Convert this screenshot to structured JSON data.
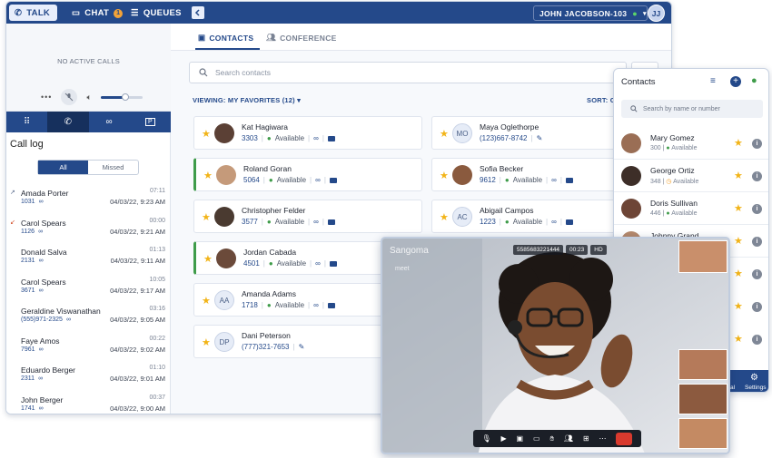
{
  "topbar": {
    "talk": "TALK",
    "chat": "CHAT",
    "chat_count": "1",
    "queues": "QUEUES",
    "user": "JOHN JACOBSON-103",
    "initials": "JJ"
  },
  "left": {
    "no_active": "NO ACTIVE CALLS",
    "volume": 0.6,
    "call_log_title": "Call log",
    "seg_all": "All",
    "seg_missed": "Missed",
    "calls": [
      {
        "name": "Amada Porter",
        "number": "1031",
        "duration": "07:11",
        "date": "04/03/22, 9:23 AM",
        "missed": false
      },
      {
        "name": "Carol Spears",
        "number": "1126",
        "duration": "00:00",
        "date": "04/03/22, 9:21 AM",
        "missed": true
      },
      {
        "name": "Donald Salva",
        "number": "2131",
        "duration": "01:13",
        "date": "04/03/22, 9:11 AM",
        "missed": false
      },
      {
        "name": "Carol Spears",
        "number": "3671",
        "duration": "10:05",
        "date": "04/03/22, 9:17 AM",
        "missed": false
      },
      {
        "name": "Geraldine Viswanathan",
        "number": "(555)971-2325",
        "duration": "03:16",
        "date": "04/03/22, 9:05 AM",
        "missed": false
      },
      {
        "name": "Faye Amos",
        "number": "7961",
        "duration": "00:22",
        "date": "04/03/22, 9:02 AM",
        "missed": false
      },
      {
        "name": "Eduardo Berger",
        "number": "2311",
        "duration": "01:10",
        "date": "04/03/22, 9:01 AM",
        "missed": false
      },
      {
        "name": "John Berger",
        "number": "1741",
        "duration": "00:37",
        "date": "04/03/22, 9:00 AM",
        "missed": false
      }
    ]
  },
  "main": {
    "tab_contacts": "CONTACTS",
    "tab_conference": "CONFERENCE",
    "search_placeholder": "Search contacts",
    "viewing": "VIEWING: MY FAVORITES (12)",
    "sort": "SORT: C",
    "cards": [
      {
        "name": "Kat Hagiwara",
        "ext": "3303",
        "status": "Available",
        "initials": "",
        "green": false
      },
      {
        "name": "Maya Oglethorpe",
        "ext": "(123)667-8742",
        "status": "",
        "initials": "MO",
        "green": false
      },
      {
        "name": "Roland Goran",
        "ext": "5064",
        "status": "Available",
        "initials": "",
        "green": true
      },
      {
        "name": "Sofia Becker",
        "ext": "9612",
        "status": "Available",
        "initials": "",
        "green": false
      },
      {
        "name": "Christopher Felder",
        "ext": "3577",
        "status": "Available",
        "initials": "",
        "green": false
      },
      {
        "name": "Abigail Campos",
        "ext": "1223",
        "status": "Available",
        "initials": "AC",
        "green": false
      },
      {
        "name": "Jordan Cabada",
        "ext": "4501",
        "status": "Available",
        "initials": "",
        "green": true
      },
      {
        "name": "Amanda Adams",
        "ext": "1718",
        "status": "Available",
        "initials": "AA",
        "green": false
      },
      {
        "name": "Dani Peterson",
        "ext": "(777)321-7653",
        "status": "",
        "initials": "DP",
        "green": false
      }
    ]
  },
  "contacts_panel": {
    "title": "Contacts",
    "search_placeholder": "Search by name or number",
    "items": [
      {
        "name": "Mary Gomez",
        "ext": "300",
        "status": "Available"
      },
      {
        "name": "George Ortiz",
        "ext": "348",
        "status": "Available"
      },
      {
        "name": "Doris Sullivan",
        "ext": "446",
        "status": "Available"
      },
      {
        "name": "Johnny Grand",
        "ext": "",
        "status": ""
      }
    ],
    "bottom_left": "al",
    "settings": "Settings"
  },
  "video": {
    "logo": "Sangoma",
    "logo_sub": "meet",
    "meeting_id": "5585683221444",
    "time": "00:23",
    "quality": "HD"
  },
  "colors": {
    "brand": "#24498a",
    "available": "#3f9c4a",
    "star": "#f2b418",
    "missed": "#d0461f"
  }
}
